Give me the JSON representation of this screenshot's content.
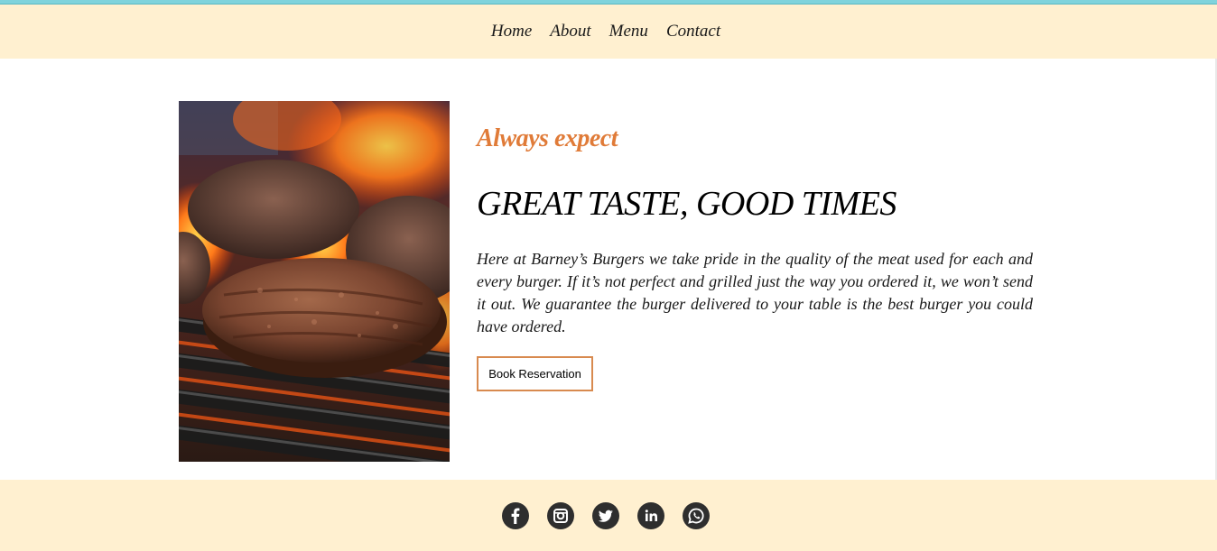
{
  "nav": {
    "items": [
      {
        "label": "Home"
      },
      {
        "label": "About"
      },
      {
        "label": "Menu"
      },
      {
        "label": "Contact"
      }
    ]
  },
  "hero": {
    "image_icon": "grilled-burger-patties-photo",
    "tagline": "Always expect",
    "headline": "GREAT TASTE, GOOD TIMES",
    "body": "Here at Barney’s Burgers we take pride in the quality of the meat used for each and every burger. If it’s not perfect and grilled just the way you ordered it, we won’t send it out. We guarantee the burger delivered to your table is the best burger you could have ordered.",
    "button_label": "Book Reservation"
  },
  "footer": {
    "social": [
      {
        "icon": "facebook-icon"
      },
      {
        "icon": "instagram-icon"
      },
      {
        "icon": "twitter-icon"
      },
      {
        "icon": "linkedin-icon"
      },
      {
        "icon": "whatsapp-icon"
      }
    ]
  },
  "colors": {
    "top_strip": "#7fd3dc",
    "header_bg": "#fff0d0",
    "footer_bg": "#fff0d0",
    "accent": "#e07b38",
    "button_border": "#d88a4f",
    "icon_bg": "#2e2e2e"
  }
}
